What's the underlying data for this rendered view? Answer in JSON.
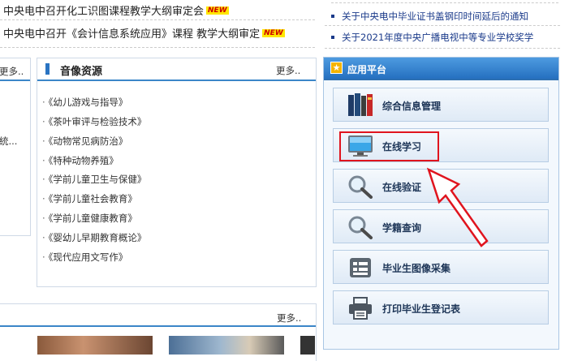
{
  "news": {
    "items": [
      {
        "text": "中央电中召开化工识图课程教学大纲审定会",
        "badge": "NEW"
      },
      {
        "text": "中央电中召开《会计信息系统应用》课程 教学大纲审定",
        "badge": "NEW"
      }
    ],
    "right_items": [
      "关于中央电中毕业证书盖钢印时间延后的通知",
      "关于2021年度中央广播电视中等专业学校奖学"
    ]
  },
  "left_panel": {
    "more": "更多..",
    "fragment": "統..."
  },
  "audio_video": {
    "title": "音像资源",
    "more": "更多..",
    "items": [
      "《幼儿游戏与指导》",
      "《茶叶审评与检验技术》",
      "《动物常见病防治》",
      "《特种动物养殖》",
      "《学前儿童卫生与保健》",
      "《学前儿童社会教育》",
      "《学前儿童健康教育》",
      "《婴幼儿早期教育概论》",
      "《现代应用文写作》"
    ]
  },
  "bottom_panel": {
    "more": "更多.."
  },
  "app_platform": {
    "title": "应用平台",
    "buttons": [
      {
        "label": "综合信息管理",
        "icon": "books-icon"
      },
      {
        "label": "在线学习",
        "icon": "monitor-icon"
      },
      {
        "label": "在线验证",
        "icon": "magnifier-icon"
      },
      {
        "label": "学籍查询",
        "icon": "magnifier-icon"
      },
      {
        "label": "毕业生图像采集",
        "icon": "id-card-icon"
      },
      {
        "label": "打印毕业生登记表",
        "icon": "printer-icon"
      }
    ]
  },
  "annotation": {
    "highlight_color": "#e0141e"
  }
}
